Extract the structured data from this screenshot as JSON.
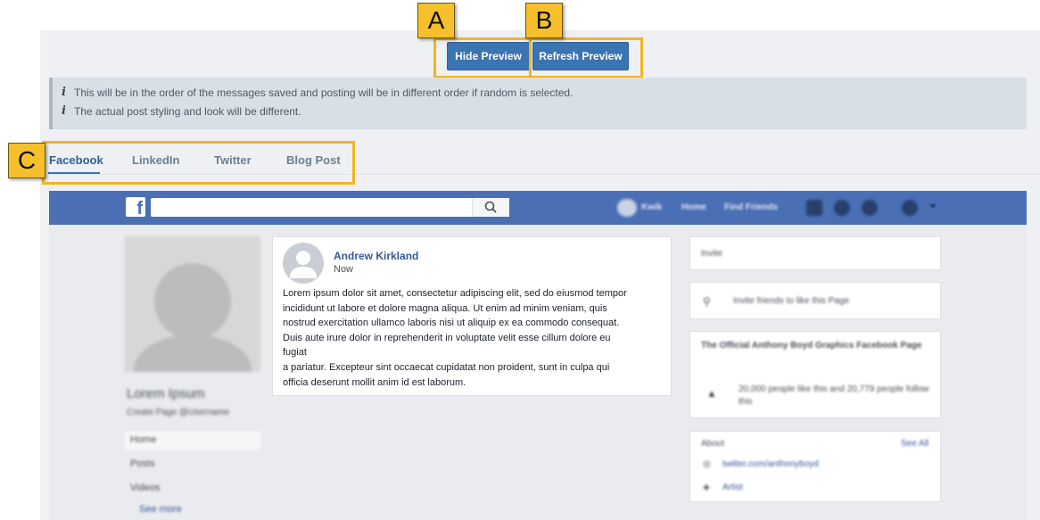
{
  "toolbar": {
    "hide_preview_label": "Hide Preview",
    "refresh_preview_label": "Refresh Preview"
  },
  "callouts": {
    "a": "A",
    "b": "B",
    "c": "C"
  },
  "info": {
    "icon": "info-icon",
    "lines": [
      "This will be in the order of the messages saved and posting will be in different order if random is selected.",
      "The actual post styling and look will be different."
    ]
  },
  "tabs": [
    {
      "label": "Facebook",
      "active": true
    },
    {
      "label": "LinkedIn",
      "active": false
    },
    {
      "label": "Twitter",
      "active": false
    },
    {
      "label": "Blog Post",
      "active": false
    }
  ],
  "preview": {
    "fb_logo": "f",
    "search_icon": "search-icon",
    "nav_items": [
      "Kwik",
      "Home",
      "Find Friends"
    ],
    "profile": {
      "name": "Lorem Ipsum",
      "handle": "Create Page @Username",
      "menu": [
        "Home",
        "Posts",
        "Videos",
        "See more"
      ]
    },
    "post": {
      "author": "Andrew Kirkland",
      "time": "Now",
      "body": "Lorem ipsum dolor sit amet, consectetur adipiscing elit, sed do eiusmod tempor\nincididunt ut labore et dolore magna aliqua. Ut enim ad minim veniam, quis\nnostrud exercitation ullamco laboris nisi ut aliquip ex ea commodo consequat.\nDuis aute irure dolor in reprehenderit in voluptate velit esse cillum dolore eu\nfugiat\na pariatur. Excepteur sint occaecat cupidatat non proident, sunt in culpa qui\nofficia deserunt mollit anim id est laborum."
    },
    "sidebar": {
      "card1_title": "Invite",
      "card2_text": "Invite friends to like this Page",
      "card3_title": "The Official Anthony Boyd Graphics Facebook Page",
      "card3_stats": "20,000 people like this and 20,779 people follow this",
      "card4_title": "About",
      "card4_link": "See All",
      "card4_url": "twitter.com/anthonyboyd",
      "card4_item": "Artist"
    }
  }
}
